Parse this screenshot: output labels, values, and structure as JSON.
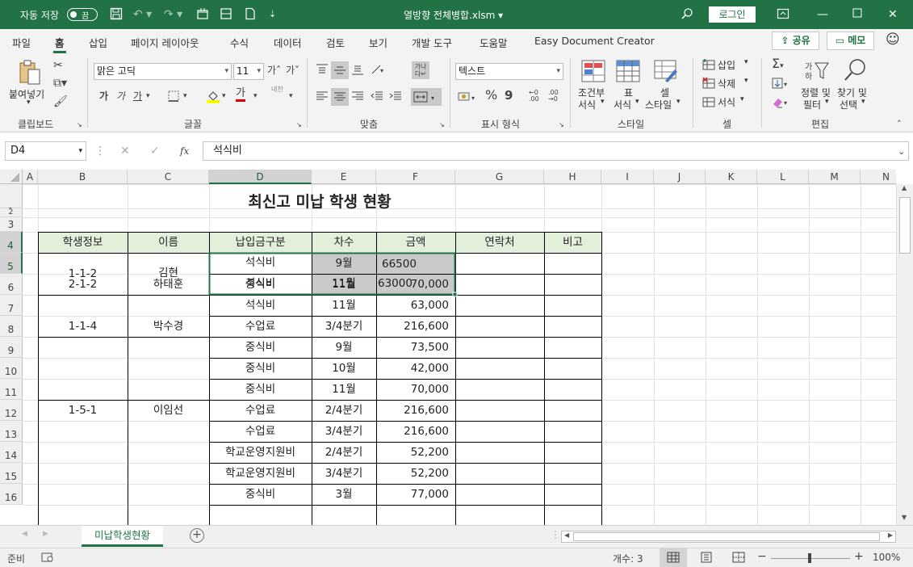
{
  "titlebar": {
    "autosave": "자동 저장",
    "toggle": "끔",
    "filename": "열방향 전체병합.xlsm ▾",
    "login": "로그인"
  },
  "menu": {
    "tabs": [
      "파일",
      "홈",
      "삽입",
      "페이지 레이아웃",
      "수식",
      "데이터",
      "검토",
      "보기",
      "개발 도구",
      "도움말",
      "Easy Document Creator"
    ],
    "share": "공유",
    "memo": "메모"
  },
  "ribbon": {
    "clipboard": {
      "paste": "붙여넣기",
      "group": "클립보드"
    },
    "font": {
      "name": "맑은 고딕",
      "size": "11",
      "bold": "가",
      "italic": "가",
      "underline": "가",
      "grow": "가˄",
      "shrink": "가˅",
      "fontcolor": "가",
      "phonetic": "내천",
      "group": "글꼴"
    },
    "align": {
      "group": "맞춤"
    },
    "number": {
      "format": "텍스트",
      "percent": "%",
      "comma": "9",
      "group": "표시 형식"
    },
    "styles": {
      "cond1": "조건부",
      "cond2": "서식",
      "table1": "표",
      "table2": "서식",
      "cell1": "셀",
      "cell2": "스타일",
      "group": "스타일"
    },
    "cells": {
      "insert": "삽입",
      "delete": "삭제",
      "format": "서식",
      "group": "셀"
    },
    "editing": {
      "sort1": "정렬 및",
      "sort2": "필터",
      "find1": "찾기 및",
      "find2": "선택",
      "group": "편집"
    }
  },
  "formula_bar": {
    "name_box": "D4",
    "fx": "fx",
    "content": "석식비"
  },
  "grid": {
    "columns": [
      "A",
      "B",
      "C",
      "D",
      "E",
      "F",
      "G",
      "H",
      "I",
      "J",
      "K",
      "L",
      "M",
      "N"
    ],
    "rows": [
      "1",
      "2",
      "3",
      "4",
      "5",
      "6",
      "7",
      "8",
      "9",
      "10",
      "11",
      "12",
      "13",
      "14",
      "15",
      "16"
    ],
    "title": "최신고 미납 학생 현황",
    "headers": [
      "학생정보",
      "이름",
      "납입금구분",
      "차수",
      "금액",
      "연락처",
      "비고"
    ],
    "cells": {
      "r4": {
        "b": "1-1-2",
        "c": "김현",
        "d": "석식비",
        "e": "9월",
        "f": "66500"
      },
      "r5": {
        "d": "석식비",
        "e": "11월",
        "f": "63000"
      },
      "r6": {
        "b": "2-1-2",
        "c": "하태훈",
        "d": "중식비",
        "e": "11월",
        "f": "70,000"
      },
      "r7": {
        "d": "석식비",
        "e": "11월",
        "f": "63,000"
      },
      "r8": {
        "b": "1-1-4",
        "c": "박수경",
        "d": "수업료",
        "e": "3/4분기",
        "f": "216,600"
      },
      "r9": {
        "d": "중식비",
        "e": "9월",
        "f": "73,500"
      },
      "r10": {
        "d": "중식비",
        "e": "10월",
        "f": "42,000"
      },
      "r11": {
        "d": "중식비",
        "e": "11월",
        "f": "70,000"
      },
      "r12": {
        "b": "1-5-1",
        "c": "이임선",
        "d": "수업료",
        "e": "2/4분기",
        "f": "216,600"
      },
      "r13": {
        "d": "수업료",
        "e": "3/4분기",
        "f": "216,600"
      },
      "r14": {
        "d": "학교운영지원비",
        "e": "2/4분기",
        "f": "52,200"
      },
      "r15": {
        "d": "학교운영지원비",
        "e": "3/4분기",
        "f": "52,200"
      },
      "r16": {
        "d": "중식비",
        "e": "3월",
        "f": "77,000"
      }
    }
  },
  "sheet_tabs": {
    "active": "미납학생현황"
  },
  "status": {
    "ready": "준비",
    "count": "개수: 3",
    "zoom": "100%"
  },
  "colors": {
    "accent": "#217346",
    "selection": "#c9c9c9",
    "header_fill": "#e2efda"
  }
}
